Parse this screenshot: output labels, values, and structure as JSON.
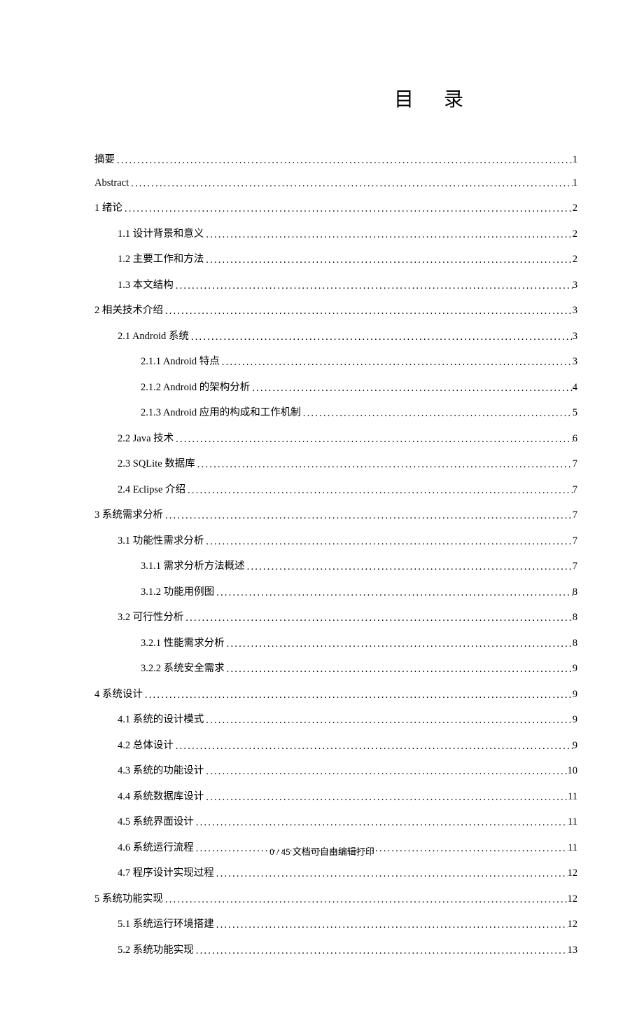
{
  "title": "目 录",
  "footer": "0 / 45 文档可自由编辑打印",
  "toc": [
    {
      "level": 0,
      "text": "摘要",
      "page": "1"
    },
    {
      "level": 0,
      "text": "Abstract",
      "page": "1"
    },
    {
      "level": 0,
      "text": "1 绪论",
      "page": "2"
    },
    {
      "level": 1,
      "text": "1.1 设计背景和意义",
      "page": "2"
    },
    {
      "level": 1,
      "text": "1.2 主要工作和方法",
      "page": "2"
    },
    {
      "level": 1,
      "text": "1.3 本文结构",
      "page": "3"
    },
    {
      "level": 0,
      "text": "2 相关技术介绍",
      "page": "3"
    },
    {
      "level": 1,
      "text": "2.1 Android 系统",
      "page": "3"
    },
    {
      "level": 2,
      "text": "2.1.1 Android 特点",
      "page": "3"
    },
    {
      "level": 2,
      "text": "2.1.2 Android 的架构分析",
      "page": "4"
    },
    {
      "level": 2,
      "text": "2.1.3 Android 应用的构成和工作机制",
      "page": "5"
    },
    {
      "level": 1,
      "text": "2.2 Java 技术",
      "page": "6"
    },
    {
      "level": 1,
      "text": "2.3 SQLite 数据库",
      "page": "7"
    },
    {
      "level": 1,
      "text": "2.4 Eclipse 介绍",
      "page": "7"
    },
    {
      "level": 0,
      "text": "3  系统需求分析",
      "page": "7"
    },
    {
      "level": 1,
      "text": "3.1  功能性需求分析",
      "page": "7"
    },
    {
      "level": 2,
      "text": "3.1.1  需求分析方法概述",
      "page": "7"
    },
    {
      "level": 2,
      "text": "3.1.2  功能用例图",
      "page": "8"
    },
    {
      "level": 1,
      "text": "3.2  可行性分析",
      "page": "8"
    },
    {
      "level": 2,
      "text": "3.2.1  性能需求分析",
      "page": "8"
    },
    {
      "level": 2,
      "text": "3.2.2  系统安全需求",
      "page": "9"
    },
    {
      "level": 0,
      "text": "4 系统设计",
      "page": "9"
    },
    {
      "level": 1,
      "text": "4.1  系统的设计模式",
      "page": "9"
    },
    {
      "level": 1,
      "text": "4.2  总体设计",
      "page": "9"
    },
    {
      "level": 1,
      "text": "4.3  系统的功能设计",
      "page": "10"
    },
    {
      "level": 1,
      "text": "4.4  系统数据库设计",
      "page": "11"
    },
    {
      "level": 1,
      "text": "4.5  系统界面设计",
      "page": "11"
    },
    {
      "level": 1,
      "text": "4.6  系统运行流程",
      "page": "11"
    },
    {
      "level": 1,
      "text": "4.7  程序设计实现过程",
      "page": "12"
    },
    {
      "level": 0,
      "text": "5  系统功能实现",
      "page": "12"
    },
    {
      "level": 1,
      "text": "5.1  系统运行环境搭建",
      "page": "12"
    },
    {
      "level": 1,
      "text": "5.2  系统功能实现",
      "page": "13"
    }
  ]
}
